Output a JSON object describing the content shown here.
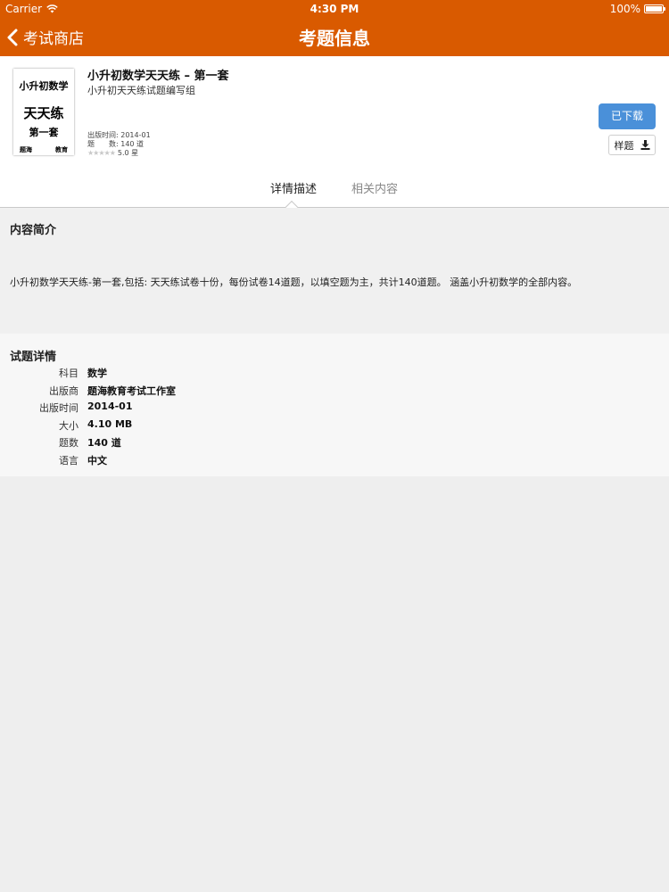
{
  "status_bar": {
    "carrier": "Carrier",
    "time": "4:30 PM",
    "battery": "100%",
    "battery_level": 1.0
  },
  "nav": {
    "back_label": "考试商店",
    "title": "考题信息"
  },
  "book": {
    "cover": {
      "line1": "小升初数学",
      "line2": "天天练",
      "line3": "第一套",
      "left_mark": "题海",
      "right_mark": "教育"
    },
    "title": "小升初数学天天练 – 第一套",
    "author": "小升初天天练试题编写组",
    "publish_date": "出版时间: 2014-01",
    "question_count": "题　　数: 140 道",
    "rating_value": 5.0,
    "rating_text": "5.0 星",
    "downloaded_label": "已下载",
    "sample_label": "样题"
  },
  "tabs": [
    {
      "label": "详情描述",
      "active": true
    },
    {
      "label": "相关内容",
      "active": false
    }
  ],
  "intro": {
    "title": "内容简介",
    "body": "小升初数学天天练-第一套,包括: 天天练试卷十份，每份试卷14道题，以填空题为主，共计140道题。 涵盖小升初数学的全部内容。"
  },
  "details": {
    "title": "试题详情",
    "rows": [
      {
        "label": "科目",
        "value": "数学"
      },
      {
        "label": "出版商",
        "value": "题海教育考试工作室"
      },
      {
        "label": "出版时间",
        "value": "2014-01"
      },
      {
        "label": "大小",
        "value": "4.10 MB"
      },
      {
        "label": "题数",
        "value": "140 道"
      },
      {
        "label": "语言",
        "value": "中文"
      }
    ]
  },
  "colors": {
    "header": "#d95a00",
    "accent_button": "#4a90d9",
    "background": "#eeeeee"
  }
}
